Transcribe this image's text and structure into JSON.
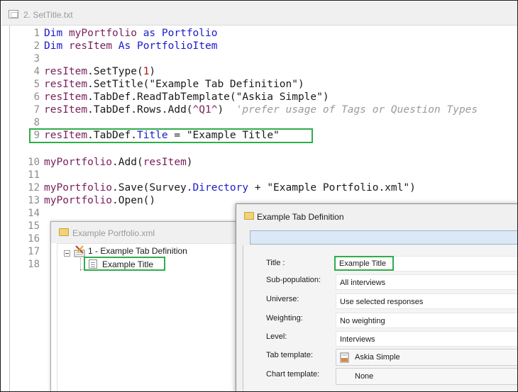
{
  "editor": {
    "title": "2. SetTitle.txt",
    "line_numbers": [
      "1",
      "2",
      "3",
      "4",
      "5",
      "6",
      "7",
      "8",
      "9",
      "10",
      "11",
      "12",
      "13",
      "14",
      "15",
      "16",
      "17",
      "18"
    ],
    "lines": {
      "l1": {
        "kw1": "Dim",
        "var": "myPortfolio",
        "kw2": "as",
        "type": "Portfolio"
      },
      "l2": {
        "kw1": "Dim",
        "var": "resItem",
        "kw2": "As",
        "type": "PortfolioItem"
      },
      "l4": {
        "obj": "resItem",
        "member": ".SetType(",
        "arg": "1",
        "end": ")"
      },
      "l5": {
        "obj": "resItem",
        "member": ".SetTitle(",
        "arg": "\"Example Tab Definition\"",
        "end": ")"
      },
      "l6": {
        "obj": "resItem",
        "m1": ".",
        "m2": "TabDef",
        "member": ".ReadTabTemplate(",
        "arg": "\"Askia Simple\"",
        "end": ")"
      },
      "l7": {
        "obj": "resItem",
        "m1": ".",
        "m2": "TabDef",
        "member": ".Rows.Add(",
        "arg": "^Q1^",
        "end": ")",
        "comment": "'prefer usage of Tags or Question Types"
      },
      "l9": {
        "obj": "resItem",
        "m1": ".",
        "m2": "TabDef",
        "m3": ".",
        "m4": "Title",
        "op": " = ",
        "arg": "\"Example Title\""
      },
      "l11": {
        "obj": "myPortfolio",
        "member": ".Add(",
        "arg": "resItem",
        "end": ")"
      },
      "l13": {
        "obj": "myPortfolio",
        "member": ".Save(Survey",
        "m2": ".Directory",
        "op": " + ",
        "arg": "\"Example Portfolio.xml\"",
        "end": ")"
      },
      "l14": {
        "obj": "myPortfolio",
        "member": ".Open()"
      }
    }
  },
  "portfolio_window": {
    "title": "Example Portfolio.xml",
    "root_item": "1 - Example Tab Definition",
    "child_item": "Example Title"
  },
  "tabdef_window": {
    "title": "Example Tab Definition",
    "fields": {
      "title": {
        "label": "Title :",
        "value": "Example Title"
      },
      "subpop": {
        "label": "Sub-population:",
        "value": "All interviews"
      },
      "universe": {
        "label": "Universe:",
        "value": "Use selected responses"
      },
      "weighting": {
        "label": "Weighting:",
        "value": "No weighting"
      },
      "level": {
        "label": "Level:",
        "value": "Interviews"
      },
      "tab_template": {
        "label": "Tab template:",
        "value": "Askia Simple"
      },
      "chart_template": {
        "label": "Chart template:",
        "value": "None"
      }
    }
  },
  "colors": {
    "highlight": "#2fad4b",
    "keyword": "#1a1acc",
    "identifier": "#7a1e5b",
    "number": "#b01010",
    "comment": "#9b9b9b"
  }
}
